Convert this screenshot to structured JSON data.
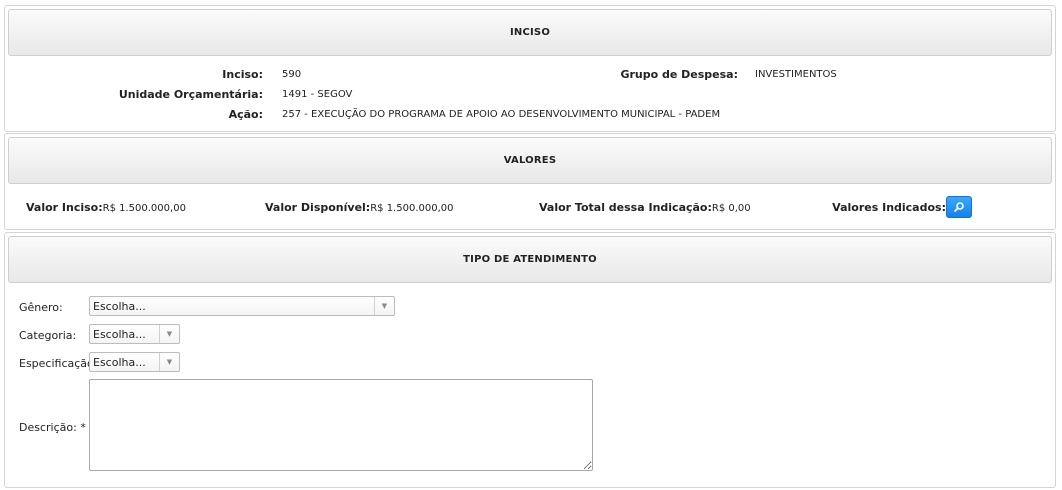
{
  "inciso_section": {
    "title": "INCISO",
    "inciso_label": "Inciso:",
    "inciso_value": "590",
    "unidade_label": "Unidade Orçamentária:",
    "unidade_value": "1491 - SEGOV",
    "acao_label": "Ação:",
    "acao_value": "257 - EXECUÇÃO DO PROGRAMA DE APOIO AO DESENVOLVIMENTO MUNICIPAL - PADEM",
    "grupo_label": "Grupo de Despesa:",
    "grupo_value": "INVESTIMENTOS"
  },
  "valores_section": {
    "title": "VALORES",
    "valor_inciso_label": "Valor Inciso:",
    "valor_inciso_value": "R$ 1.500.000,00",
    "valor_disponivel_label": "Valor Disponível:",
    "valor_disponivel_value": "R$ 1.500.000,00",
    "valor_total_label": "Valor Total dessa Indicação:",
    "valor_total_value": "R$ 0,00",
    "valores_indicados_label": "Valores Indicados:",
    "icon": "search-icon"
  },
  "atendimento_section": {
    "title": "TIPO DE ATENDIMENTO",
    "genero_label": "Gênero:",
    "genero_value": "Escolha...",
    "categoria_label": "Categoria:",
    "categoria_value": "Escolha...",
    "especificacao_label": "Especificação:",
    "especificacao_value": "Escolha...",
    "descricao_label": "Descrição: *",
    "descricao_value": ""
  },
  "colors": {
    "accent": "#1581e6",
    "header_bg": "#ececec",
    "border": "#d4d4d4"
  }
}
